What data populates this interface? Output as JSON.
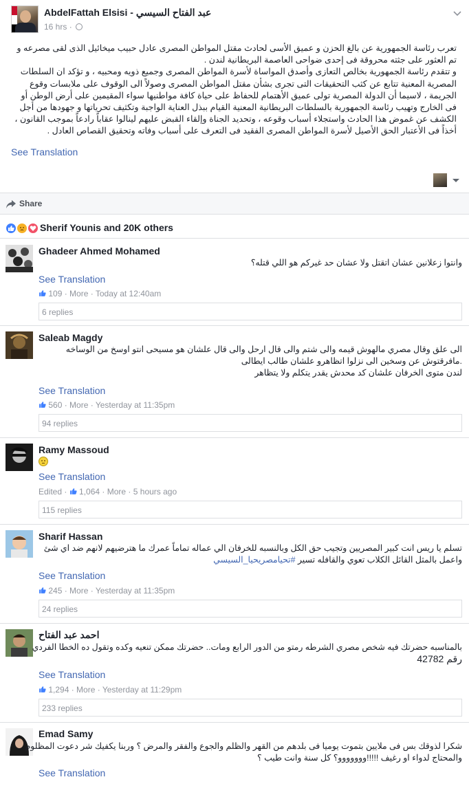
{
  "post": {
    "page_name": "AbdelFattah Elsisi - عبد الفتاح السيسي",
    "time": "16 hrs",
    "meta_separator": "·",
    "text_paragraphs": [
      "تعرب رئاسة الجمهورية عن بالغ الحزن و عميق الأسى لحادث مقتل المواطن المصرى عادل حبيب ميخائيل الذى لقى مصرعه و تم العثور على جثته محروقة فى إحدى ضواحى العاصمة البريطانية لندن .",
      "و تتقدم رئاسة الجمهورية بخالص التعازى وأصدق المواساة لأسرة المواطن المصرى وجميع ذويه ومحبيه ، و تؤكد ان السلطات المصرية المعنية تتابع عن كثب التحقيقات التى تجرى بشأن مقتل المواطن المصرى وصولاً الى الوقوف على ملابسات وقوع الجريمة ، لاسيما أن الدولة المصرية تولى عميق الأهتمام للحفاظ على حياة كافة مواطنيها سواء المقيمين على أرض الوطن أو فى الخارج وتهيب رئاسة الجمهورية بالسلطات البريطانية المعنية القيام ببذل العناية الواجبة وتكثيف تحرياتها و جهودها من أجل الكشف عن غموض هذا الحادث واستجلاء أسباب وقوعه ، وتحديد الجناة وإلقاء القبض عليهم لينالوا عقاباً رادعاً بموجب القانون ، أخذاً فى الأعتبار الحق الأصيل لأسرة المواطن المصرى الفقيد فى التعرف على أسباب وفاته وتحقيق القصاص العادل ."
    ],
    "see_translation": "See Translation",
    "share_label": "Share",
    "reactions_label": "Sherif Younis and 20K others"
  },
  "comments": [
    {
      "author": "Ghadeer Ahmed Mohamed",
      "lines": [
        "وانتوا زعلانين عشان اتقتل ولا عشان حد غيركم هو اللي قتله؟"
      ],
      "see_translation": "See Translation",
      "likes": "109",
      "more": "More",
      "time": "Today at 12:40am",
      "replies": "6 replies"
    },
    {
      "author": "Saleab Magdy",
      "lines": [
        "الى علق وقال مصري مالهوش قيمه والى شتم والى قال ارحل والى قال علشان هو مسيحى انتو اوسخ من الوساخه",
        ".مافرقتوش عن وسخين الى نزلوا اتظاهرو علشان طالب ايطالى",
        "لندن متوى الخرفان علشان كد محدش يقدر يتكلم ولا يتظاهر"
      ],
      "see_translation": "See Translation",
      "likes": "560",
      "more": "More",
      "time": "Yesterday at 11:35pm",
      "replies": "94 replies"
    },
    {
      "author": "Ramy Massoud",
      "lines": [],
      "see_translation": "See Translation",
      "edited": "Edited",
      "likes": "1,064",
      "more": "More",
      "time": "5 hours ago",
      "replies": "115 replies"
    },
    {
      "author": "Sharif Hassan",
      "lines": [
        "تسلم يا ريس انت كبير المصريين وتجيب حق الكل وبالنسبه للخرفان الي عماله تماماً عمرك ما هترضيهم لانهم ضد اي شئ",
        "واعمل بالمثل القائل الكلاب تعوي والقافله تسير"
      ],
      "hashtag": "#تحيامصريحيا_السيسي",
      "see_translation": "See Translation",
      "likes": "245",
      "more": "More",
      "time": "Yesterday at 11:35pm",
      "replies": "24 replies"
    },
    {
      "author": "احمد عبد الفتاح",
      "lines": [
        "بالمناسبه حضرتك فيه شخص مصري الشرطه رمتو من الدور الرابع ومات.. حضرتك ممكن تنعيه وكده وتقول ده الخطا الفردي",
        "رقم 42782"
      ],
      "see_translation": "See Translation",
      "likes": "1,294",
      "more": "More",
      "time": "Yesterday at 11:29pm",
      "replies": "233 replies"
    },
    {
      "author": "Emad Samy",
      "lines": [
        "شكرا لذوقك بس فى ملايين بتموت يوميا فى بلدهم من القهر والظلم والجوع والفقر والمرض ؟ وربنا يكفيك شر دعوت المظلوم",
        "والمحتاج لدواء او رغيف !!!!!ووووووو؟ كل سنة وانت طيب ؟"
      ],
      "see_translation": "See Translation"
    }
  ],
  "icons": {
    "globe": "globe-icon",
    "chevron": "chevron-down-icon",
    "share": "share-arrow-icon",
    "like": "like-reaction-icon",
    "sad": "sad-reaction-icon",
    "love": "love-reaction-icon",
    "thumb": "thumbs-up-icon",
    "smiley": "smiley-emoji-icon"
  },
  "colors": {
    "link": "#4267b2",
    "muted": "#90949c",
    "like_blue": "#4080ff"
  }
}
